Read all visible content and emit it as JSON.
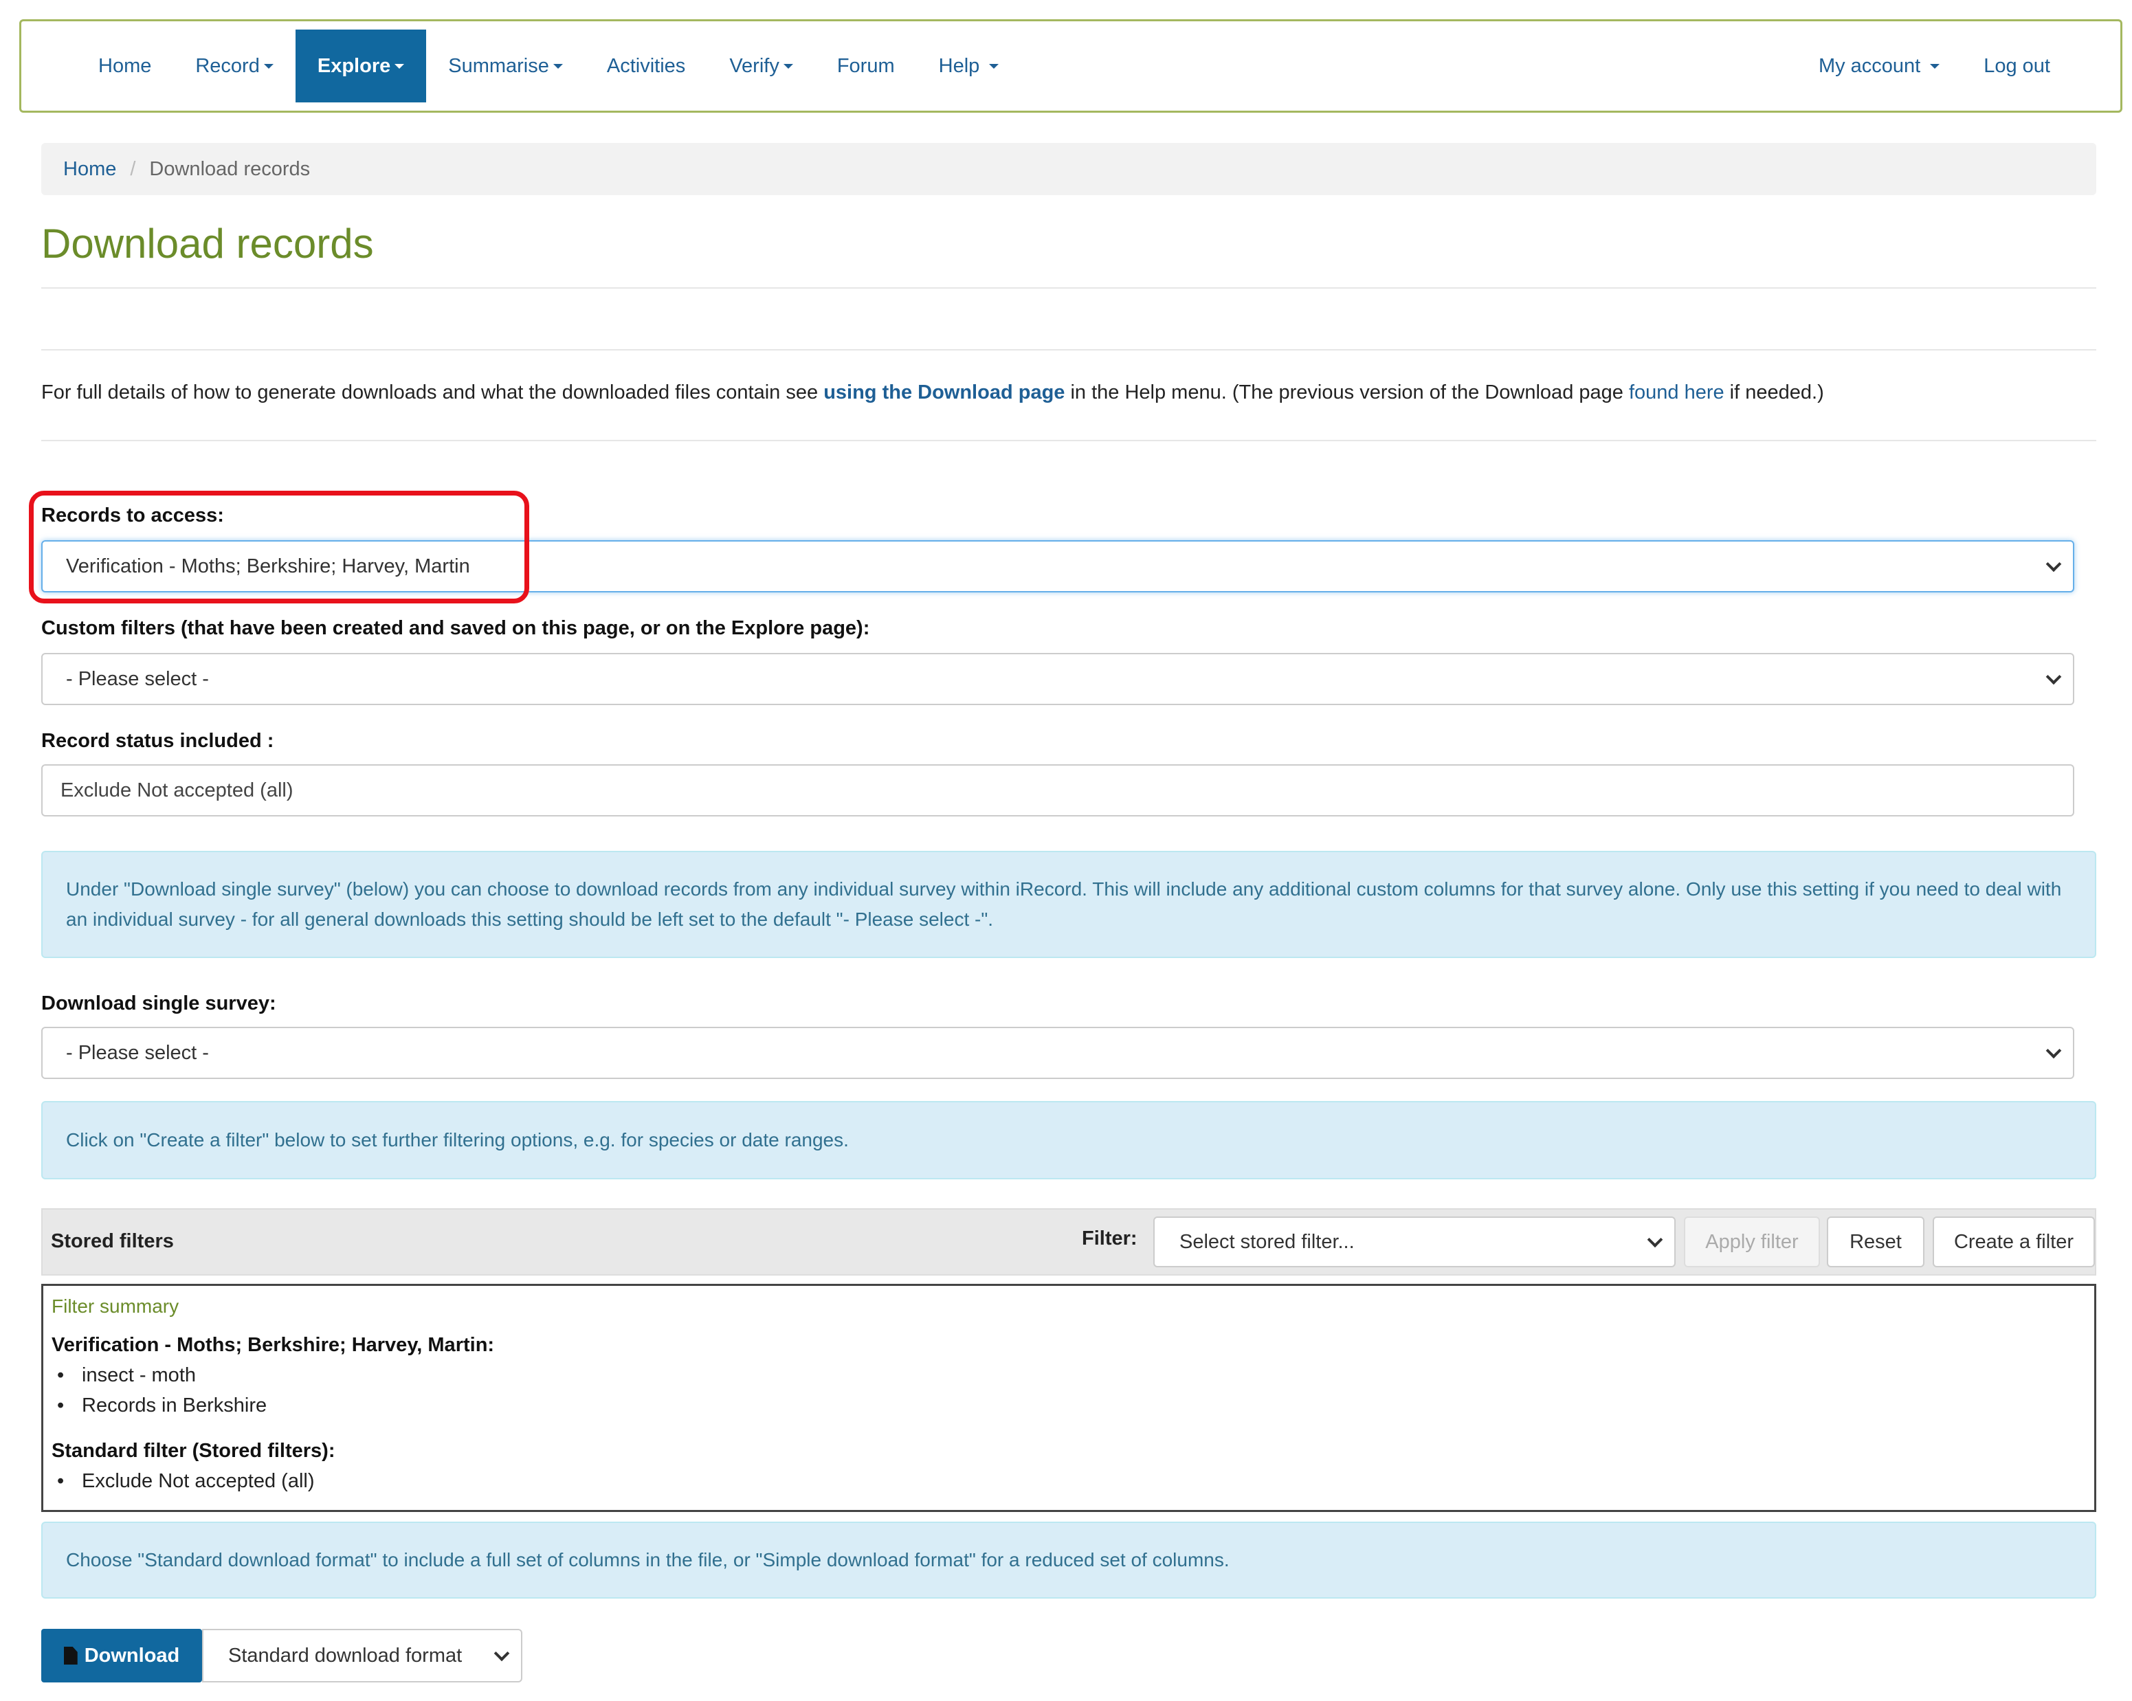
{
  "nav": {
    "left": [
      {
        "label": "Home",
        "caret": false,
        "active": false
      },
      {
        "label": "Record",
        "caret": true,
        "active": false
      },
      {
        "label": "Explore",
        "caret": true,
        "active": true
      },
      {
        "label": "Summarise",
        "caret": true,
        "active": false
      },
      {
        "label": "Activities",
        "caret": false,
        "active": false
      },
      {
        "label": "Verify",
        "caret": true,
        "active": false
      },
      {
        "label": "Forum",
        "caret": false,
        "active": false
      },
      {
        "label": "Help",
        "caret": true,
        "active": false
      }
    ],
    "right": [
      {
        "label": "My account",
        "caret": true
      },
      {
        "label": "Log out",
        "caret": false
      }
    ]
  },
  "breadcrumb": {
    "home": "Home",
    "separator": "/",
    "current": "Download records"
  },
  "page_title": "Download records",
  "intro": {
    "text1": "For full details of how to generate downloads and what the downloaded files contain see ",
    "link1": "using the Download page",
    "text2": " in the Help menu. (The previous version of the Download page ",
    "link2": "found here",
    "text3": " if needed.)"
  },
  "form": {
    "records_label": "Records to access:",
    "records_value": "Verification - Moths; Berkshire; Harvey, Martin",
    "custom_label": "Custom filters (that have been created and saved on this page, or on the Explore page):",
    "custom_value": "- Please select -",
    "status_label": "Record status included :",
    "status_value": "Exclude Not accepted (all)",
    "survey_info": "Under \"Download single survey\" (below) you can choose to download records from any individual survey within iRecord. This will include any additional custom columns for that survey alone. Only use this setting if you need to deal with an individual survey - for all general downloads this setting should be left set to the default \"- Please select -\".",
    "survey_label": "Download single survey:",
    "survey_value": "- Please select -",
    "filter_info": "Click on \"Create a filter\" below to set further filtering options, e.g. for species or date ranges."
  },
  "stored_filters": {
    "title": "Stored filters",
    "filter_label": "Filter:",
    "select_placeholder": "Select stored filter...",
    "apply": "Apply filter",
    "reset": "Reset",
    "create": "Create a filter"
  },
  "summary": {
    "heading": "Filter summary",
    "group1": "Verification - Moths; Berkshire; Harvey, Martin:",
    "group1_items": [
      "insect - moth",
      "Records in Berkshire"
    ],
    "group2": "Standard filter (Stored filters):",
    "group2_items": [
      "Exclude Not accepted (all)"
    ]
  },
  "format_info": "Choose \"Standard download format\" to include a full set of columns in the file, or \"Simple download format\" for a reduced set of columns.",
  "download": {
    "button": "Download",
    "format": "Standard download format"
  },
  "colors": {
    "accent": "#11689f",
    "title_green": "#6b8c2a",
    "highlight": "#e8111b",
    "info_bg": "#d9edf7"
  }
}
